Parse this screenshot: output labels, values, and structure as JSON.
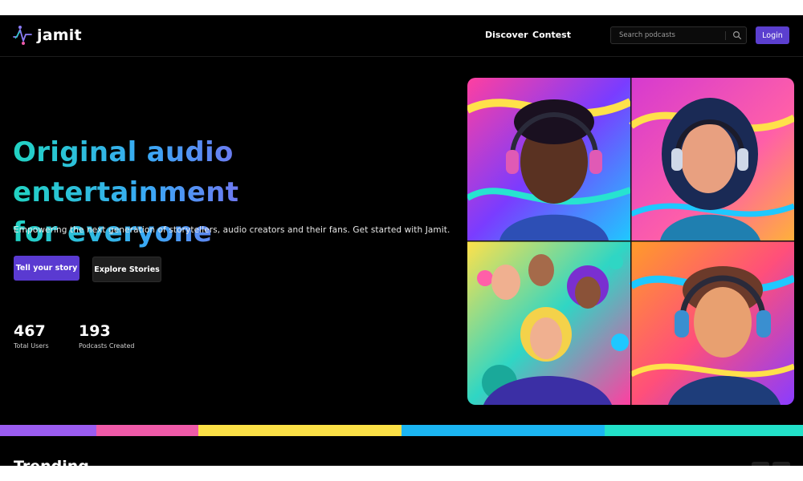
{
  "brand": {
    "name": "jamit"
  },
  "nav": {
    "links": [
      {
        "label": "Discover"
      },
      {
        "label": "Contest"
      }
    ],
    "search_placeholder": "Search podcasts",
    "login_label": "Login"
  },
  "hero": {
    "headline_line1": "Original audio entertainment",
    "headline_line2": "for everyone",
    "subtitle": "Empowering the next generation of storytellers, audio creators and their fans. Get started with Jamit.",
    "primary_cta": "Tell your story",
    "secondary_cta": "Explore Stories",
    "stats": [
      {
        "value": "467",
        "label": "Total Users"
      },
      {
        "value": "193",
        "label": "Podcasts Created"
      }
    ]
  },
  "stripe_colors": [
    "#9a5cf0",
    "#ef5aa8",
    "#fbe046",
    "#1bb5f2",
    "#22e1c9"
  ],
  "section": {
    "heading": "Trending"
  },
  "icons": {
    "search": "search-icon",
    "logo": "logo-icon",
    "prev": "chevron-left-icon",
    "next": "chevron-right-icon"
  }
}
